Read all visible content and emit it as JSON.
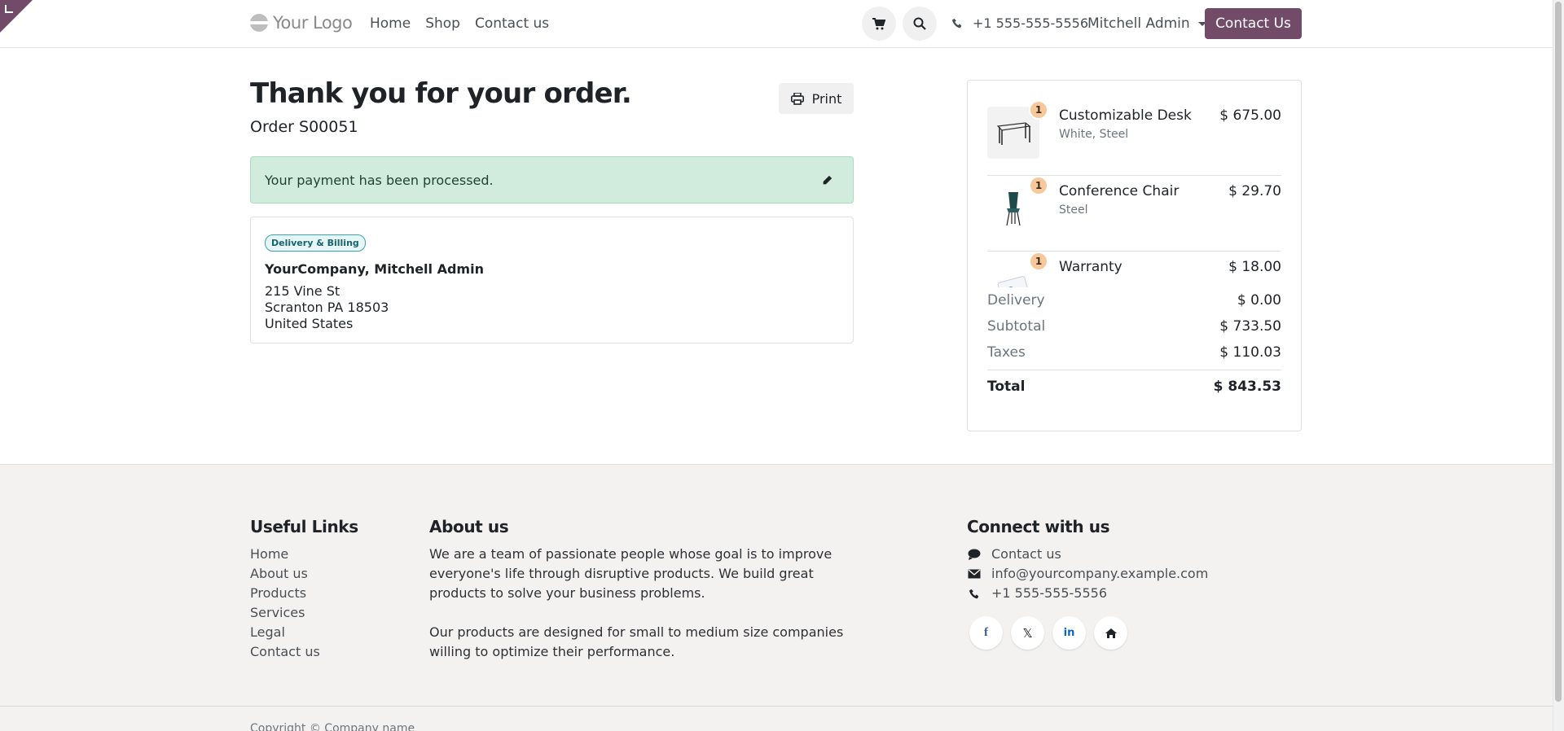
{
  "header": {
    "logo": "Your Logo",
    "nav": [
      "Home",
      "Shop",
      "Contact us"
    ],
    "phone": "+1 555-555-5556",
    "user": "Mitchell Admin",
    "cta": "Contact Us"
  },
  "main": {
    "title": "Thank you for your order.",
    "order": "Order S00051",
    "print": "Print",
    "alert": "Your payment has been processed.",
    "address": {
      "badge": "Delivery & Billing",
      "name": "YourCompany, Mitchell Admin",
      "line1": "215 Vine St",
      "line2": "Scranton PA 18503",
      "line3": "United States"
    }
  },
  "summary": {
    "items": [
      {
        "qty": "1",
        "name": "Customizable Desk",
        "variant": "White, Steel",
        "price": "$ 675.00"
      },
      {
        "qty": "1",
        "name": "Conference Chair",
        "variant": "Steel",
        "price": "$ 29.70"
      },
      {
        "qty": "1",
        "name": "Warranty",
        "variant": "",
        "price": "$ 18.00"
      }
    ],
    "delivery_label": "Delivery",
    "delivery": "$ 0.00",
    "subtotal_label": "Subtotal",
    "subtotal": "$ 733.50",
    "taxes_label": "Taxes",
    "taxes": "$ 110.03",
    "total_label": "Total",
    "total": "$ 843.53"
  },
  "footer": {
    "links_title": "Useful Links",
    "links": [
      "Home",
      "About us",
      "Products",
      "Services",
      "Legal",
      "Contact us"
    ],
    "about_title": "About us",
    "about_p1": "We are a team of passionate people whose goal is to improve everyone's life through disruptive products. We build great products to solve your business problems.",
    "about_p2": "Our products are designed for small to medium size companies willing to optimize their performance.",
    "connect_title": "Connect with us",
    "connect_contact": "Contact us",
    "connect_email": "info@yourcompany.example.com",
    "connect_phone": "+1 555-555-5556",
    "copyright": "Copyright © Company name"
  },
  "colors": {
    "brand": "#714b67",
    "alert_bg": "#d1ecdc",
    "footer_bg": "#f4f2f0"
  }
}
